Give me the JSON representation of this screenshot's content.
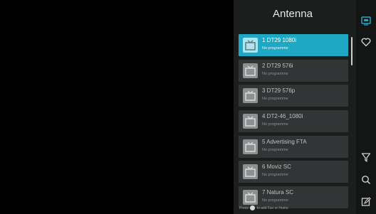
{
  "panel": {
    "title": "Antenna"
  },
  "channels": [
    {
      "name": "1 DT29 1080i",
      "subtitle": "No programme",
      "active": true
    },
    {
      "name": "2 DT29 576i",
      "subtitle": "No programme",
      "active": false
    },
    {
      "name": "3 DT29 576p",
      "subtitle": "No programme",
      "active": false
    },
    {
      "name": "4 DT2-46_1080i",
      "subtitle": "No programme",
      "active": false
    },
    {
      "name": "5 Advertising FTA",
      "subtitle": "No programme",
      "active": false
    },
    {
      "name": "6 Moviz SC",
      "subtitle": "No programme",
      "active": false
    },
    {
      "name": "7 Natura SC",
      "subtitle": "No programme",
      "active": false
    }
  ],
  "hint": {
    "before": "Press",
    "after": "to add Fav or Home"
  },
  "side_icons": [
    "tv-icon",
    "heart-icon",
    "filter-icon",
    "search-icon",
    "edit-icon"
  ],
  "colors": {
    "accent": "#1fa8c4",
    "item_bg": "#323535",
    "panel_bg": "#1c1e1e"
  }
}
